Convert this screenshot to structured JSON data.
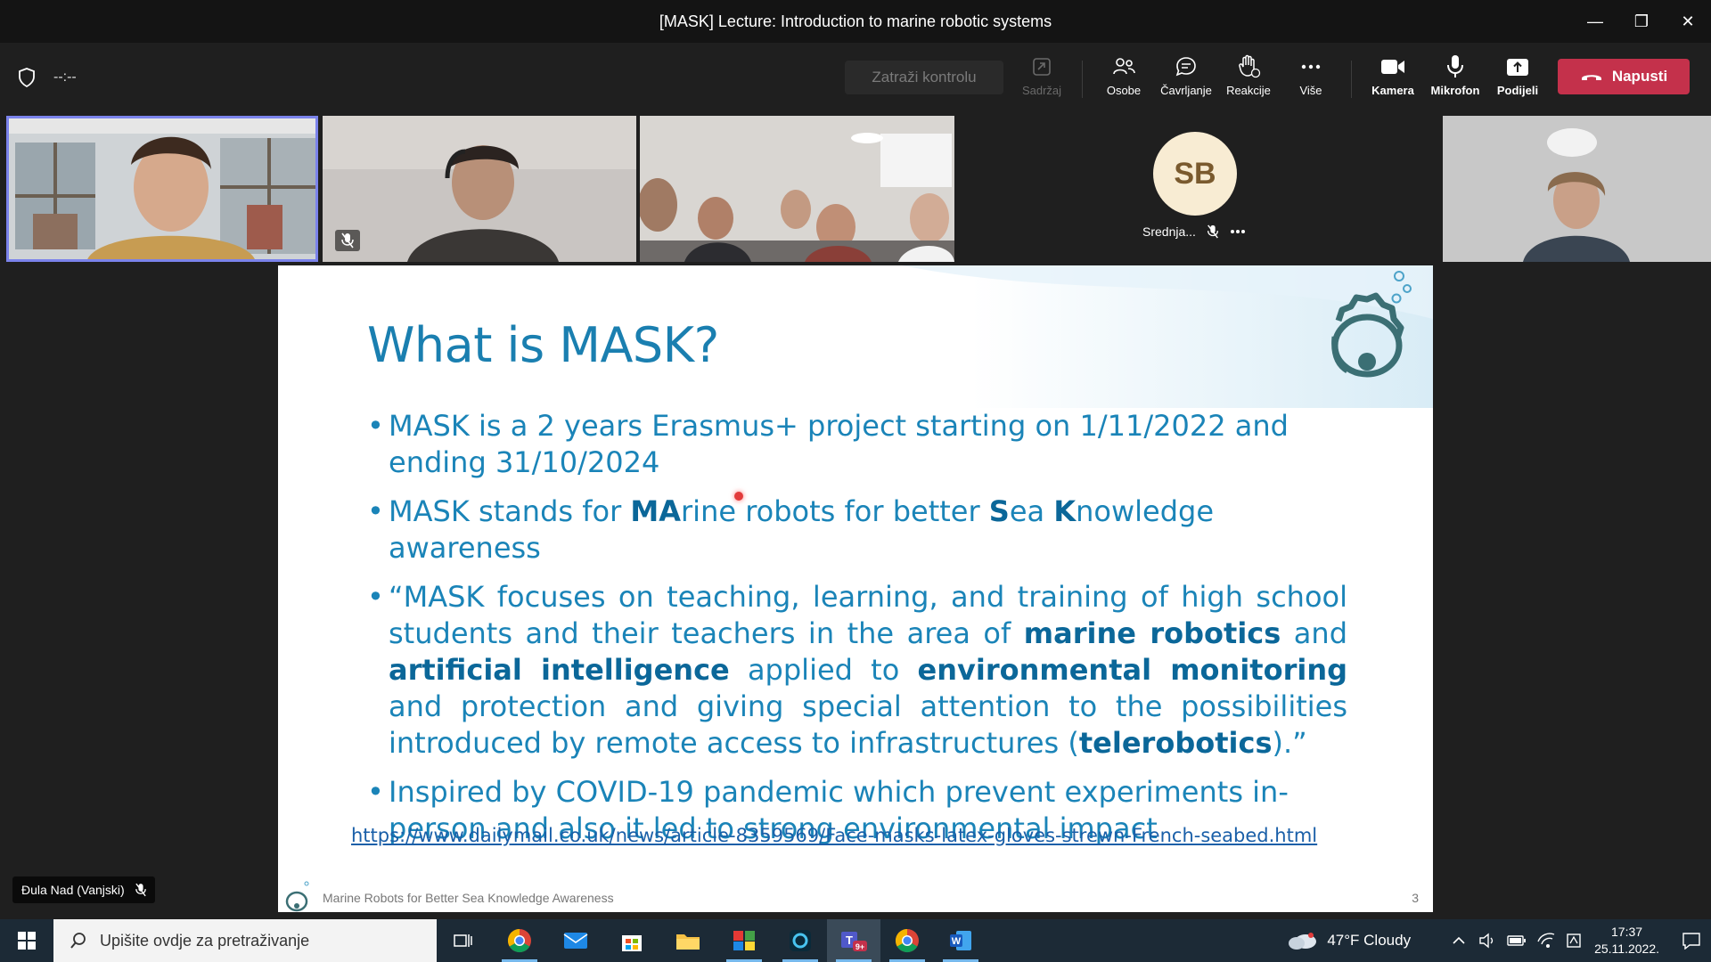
{
  "window": {
    "title": "[MASK] Lecture: Introduction to marine robotic systems",
    "controls": {
      "minimize": "—",
      "restore": "❐",
      "close": "✕"
    }
  },
  "toolbar": {
    "timer": "--:--",
    "request_control": "Zatraži kontrolu",
    "buttons": [
      {
        "label": "Sadržaj",
        "icon": "share-content-icon",
        "disabled": true
      },
      {
        "label": "Osobe",
        "icon": "people-icon"
      },
      {
        "label": "Čavrljanje",
        "icon": "chat-icon"
      },
      {
        "label": "Reakcije",
        "icon": "raise-hand-icon"
      },
      {
        "label": "Više",
        "icon": "more-icon"
      },
      {
        "label": "Kamera",
        "icon": "camera-icon"
      },
      {
        "label": "Mikrofon",
        "icon": "microphone-icon"
      },
      {
        "label": "Podijeli",
        "icon": "share-tray-icon"
      }
    ],
    "leave_label": "Napusti"
  },
  "participants": {
    "sb_initials": "SB",
    "sb_name": "Srednja..."
  },
  "slide": {
    "title": "What is MASK?",
    "bullet1": "MASK is a 2 years Erasmus+ project starting on 1/11/2022 and ending 31/10/2024",
    "bullet2_parts": [
      "MASK stands for ",
      "MA",
      "rine robots for better ",
      "S",
      "ea ",
      "K",
      "nowledge awareness"
    ],
    "bullet3_parts": [
      "“MASK focuses on teaching, learning, and training of high school students and their teachers in the area of ",
      "marine robotics",
      " and ",
      "artificial intelligence",
      " applied to ",
      "environmental monitoring",
      " and protection and giving special attention to the possibilities introduced by remote access to infrastructures (",
      "telerobotics",
      ").”"
    ],
    "bullet4": "Inspired by COVID-19 pandemic which prevent experiments in-person and also it led to strong environmental impact",
    "link": "https://www.dailymail.co.uk/news/article-8359569/Face-masks-latex-gloves-strewn-French-seabed.html",
    "footer": "Marine Robots for Better Sea Knowledge Awareness",
    "page": "3"
  },
  "speaker": {
    "name": "Đula Nad (Vanjski)"
  },
  "taskbar": {
    "search_placeholder": "Upišite ovdje za pretraživanje",
    "teams_badge": "9+",
    "weather": "47°F  Cloudy",
    "time": "17:37",
    "date": "25.11.2022."
  }
}
